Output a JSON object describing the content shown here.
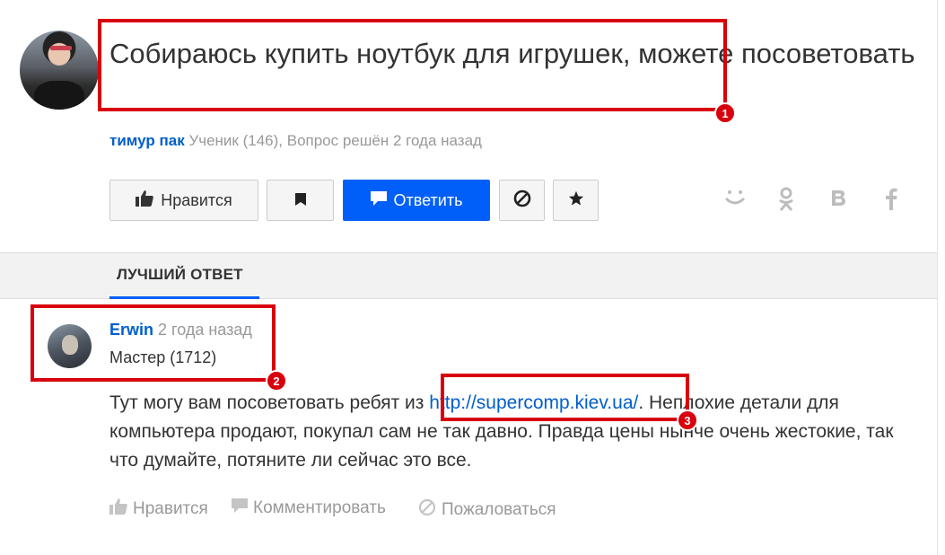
{
  "question": {
    "title": "Собираюсь купить ноутбук для игрушек, можете посоветовать",
    "author": "тимур пак",
    "meta": "Ученик (146), Вопрос решён 2 года назад"
  },
  "actions": {
    "like_label": "Нравится",
    "answer_label": "Ответить"
  },
  "share_icons": [
    "smile-icon",
    "odnoklassniki-icon",
    "vk-icon",
    "facebook-icon"
  ],
  "tabs": {
    "best_answer": "ЛУЧШИЙ ОТВЕТ"
  },
  "answer": {
    "author": "Erwin",
    "time": "2 года назад",
    "rank": "Мастер (1712)",
    "text_before": "Тут могу вам посоветовать ребят из ",
    "link": "http://supercomp.kiev.ua/",
    "text_after": ". Неплохие детали для компьютера продают, покупал сам не так давно. Правда цены нынче очень жестокие, так что думайте, потяните ли сейчас это все."
  },
  "answer_actions": {
    "like": "Нравится",
    "comment": "Комментировать",
    "report": "Пожаловаться"
  },
  "annotations": [
    "1",
    "2",
    "3"
  ],
  "colors": {
    "accent": "#005ff9",
    "link": "#005ecc",
    "highlight": "#d9000d"
  }
}
